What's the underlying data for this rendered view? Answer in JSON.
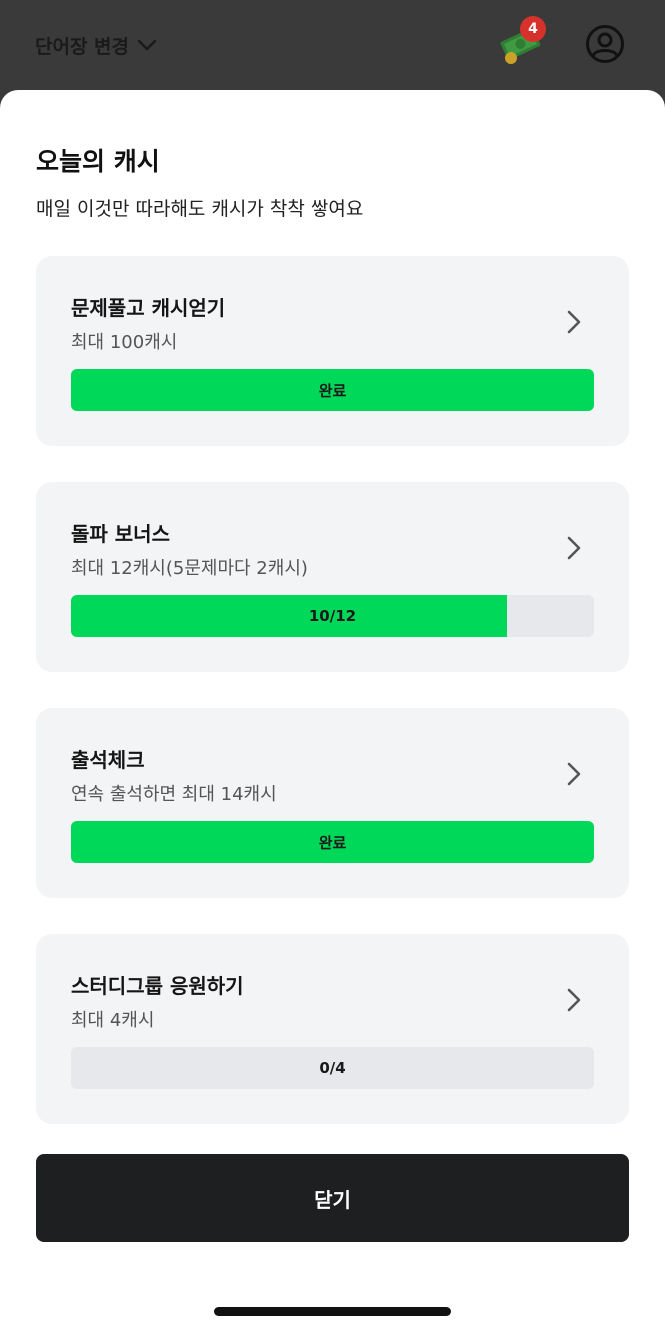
{
  "header": {
    "vocab_switch_label": "단어장 변경",
    "cash_badge_count": "4"
  },
  "sheet": {
    "title": "오늘의 캐시",
    "subtitle": "매일 이것만 따라해도 캐시가 착착 쌓여요",
    "close_label": "닫기"
  },
  "tasks": [
    {
      "title": "문제풀고 캐시얻기",
      "desc": "최대 100캐시",
      "progress_label": "완료",
      "progress": 1.0
    },
    {
      "title": "돌파 보너스",
      "desc": "최대 12캐시(5문제마다 2캐시)",
      "progress_label": "10/12",
      "progress": 0.833
    },
    {
      "title": "출석체크",
      "desc": "연속 출석하면 최대 14캐시",
      "progress_label": "완료",
      "progress": 1.0
    },
    {
      "title": "스터디그룹 응원하기",
      "desc": "최대 4캐시",
      "progress_label": "0/4",
      "progress": 0.0
    }
  ],
  "colors": {
    "progress_fill": "#00d85a",
    "progress_track": "#e6e8eb",
    "card_bg": "#f3f4f6",
    "close_button_bg": "#1e1f21",
    "badge_bg": "#d7312c"
  },
  "icons": {
    "vocab_switch": "chevron-down-icon",
    "cash": "cash-money-icon",
    "profile": "user-circle-icon",
    "card_arrow": "chevron-right-icon"
  }
}
